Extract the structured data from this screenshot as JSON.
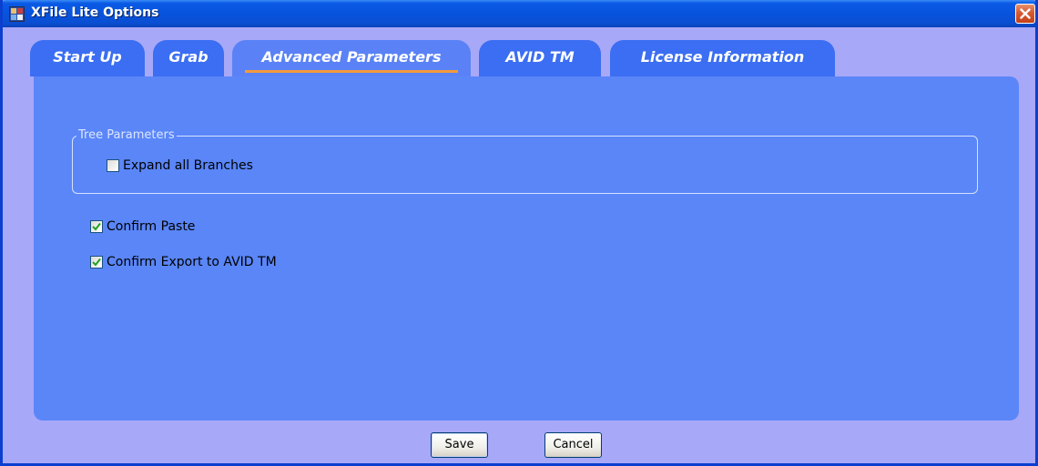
{
  "window": {
    "title": "XFile Lite Options",
    "icon": "xfile-app-icon",
    "close_icon": "close-x-icon"
  },
  "tabs": [
    {
      "label": "Start Up",
      "active": false
    },
    {
      "label": "Grab",
      "active": false
    },
    {
      "label": "Advanced Parameters",
      "active": true
    },
    {
      "label": "AVID TM",
      "active": false
    },
    {
      "label": "License Information",
      "active": false
    }
  ],
  "tree_parameters": {
    "legend": "Tree Parameters",
    "expand_all": {
      "label": "Expand all Branches",
      "checked": false
    }
  },
  "options": {
    "confirm_paste": {
      "label": "Confirm Paste",
      "checked": true
    },
    "confirm_export": {
      "label": "Confirm Export to AVID TM",
      "checked": true
    }
  },
  "buttons": {
    "save": "Save",
    "cancel": "Cancel"
  },
  "colors": {
    "titlebar": "#0a53dc",
    "window_bg": "#a8a8f8",
    "tab": "#3b6ef2",
    "panel": "#5a86f8",
    "active_tab_underline": "#f39a3d",
    "checkmark": "#21a121"
  }
}
